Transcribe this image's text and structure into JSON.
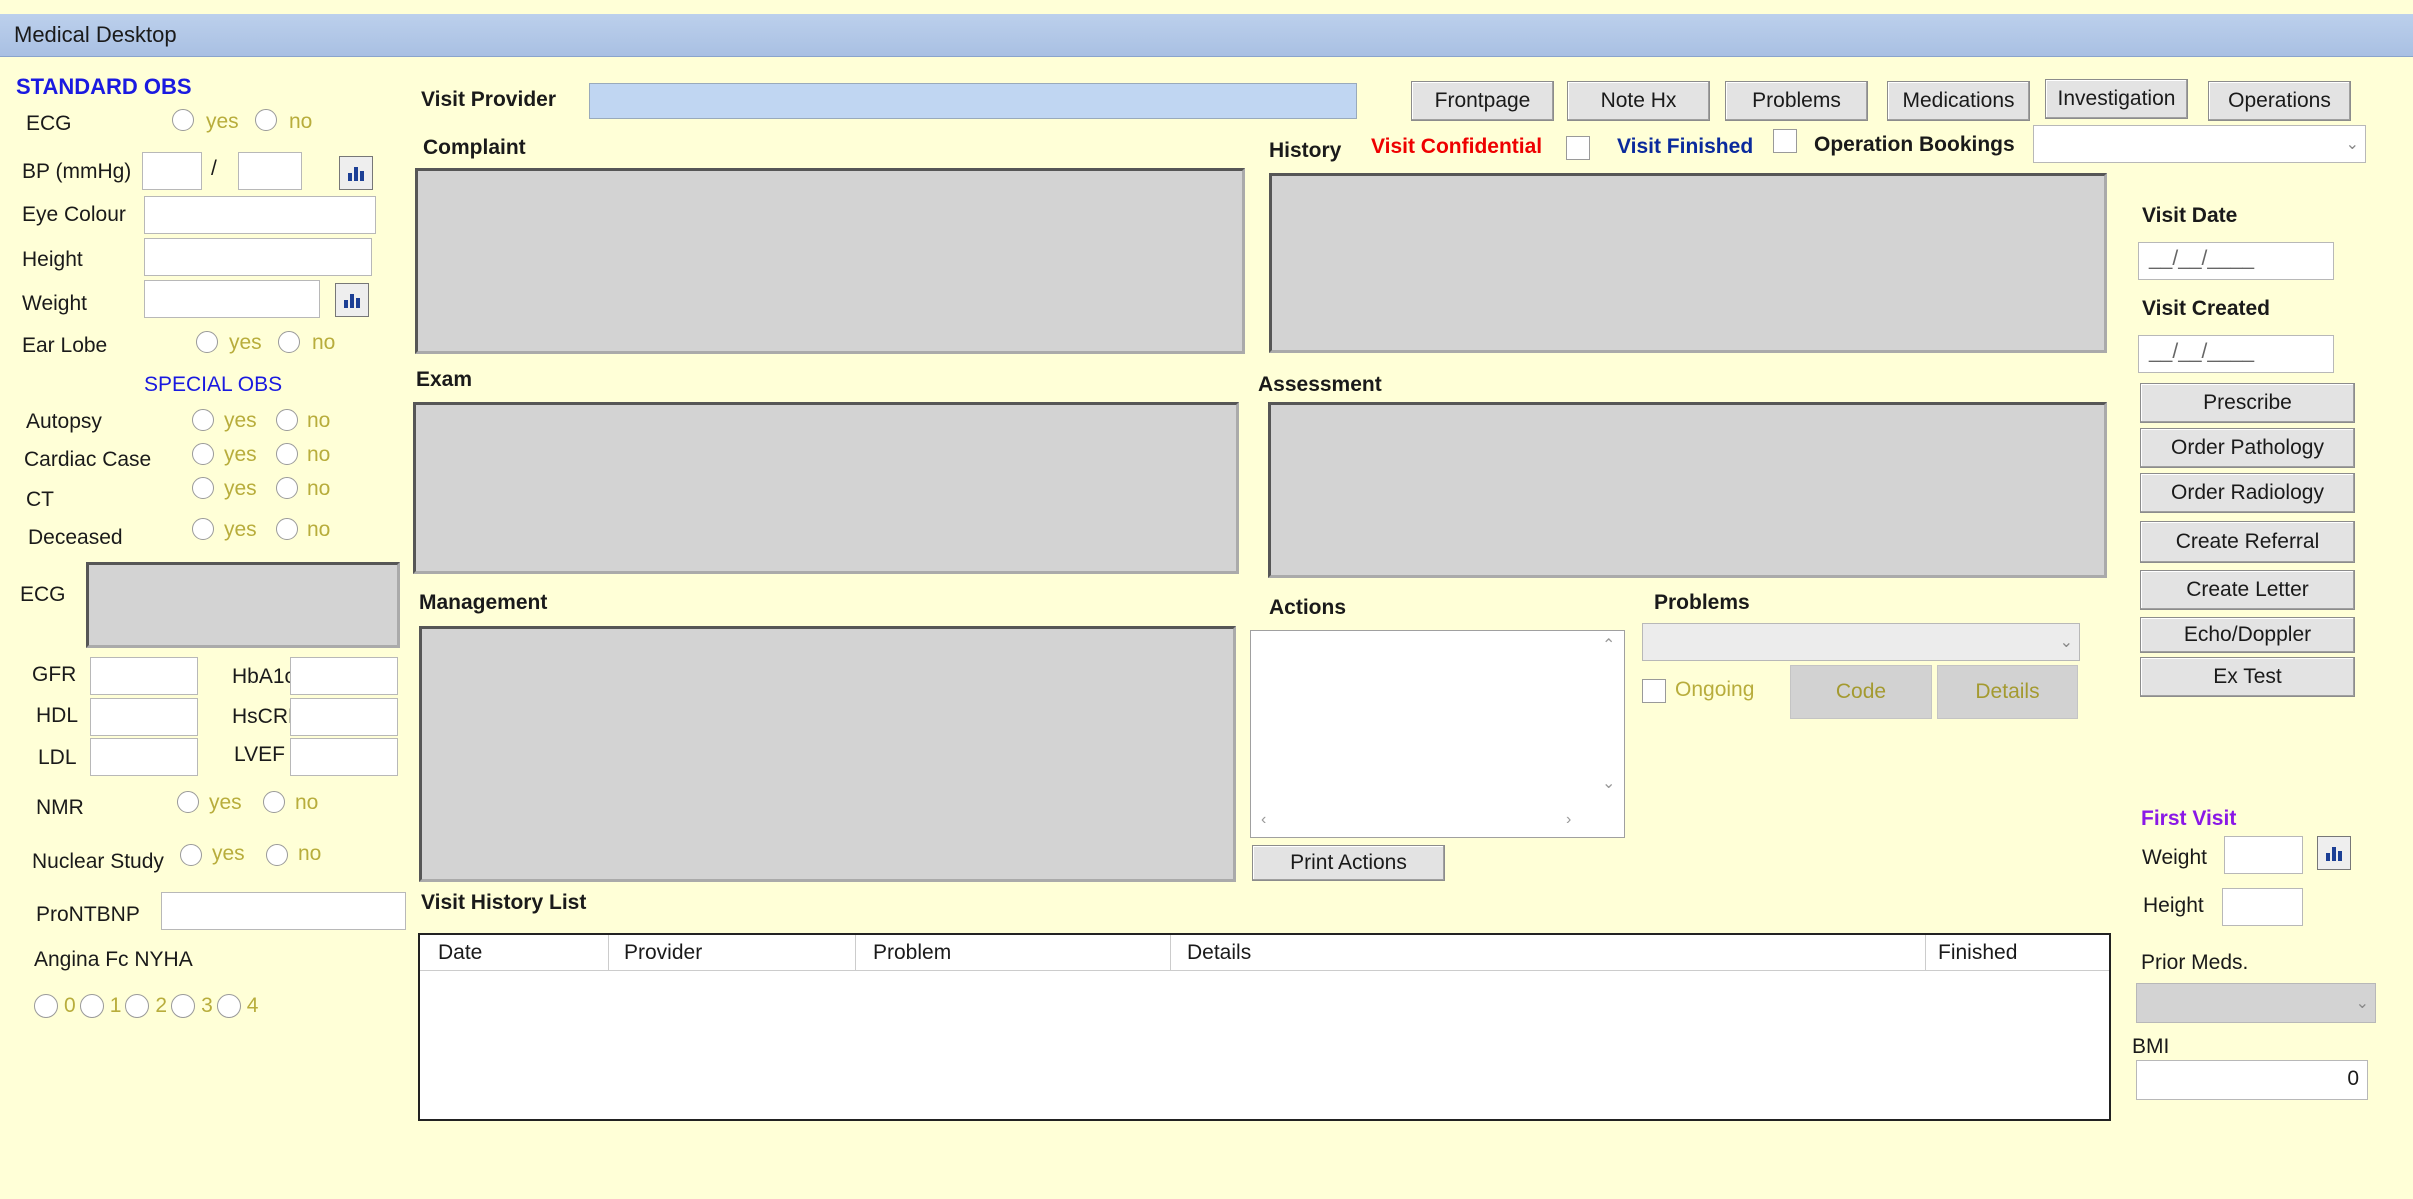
{
  "window": {
    "title": "Medical Desktop"
  },
  "std_obs": {
    "title": "STANDARD OBS",
    "ecg": "ECG",
    "bp": "BP (mmHg)",
    "bp_sep": "/",
    "eye_colour": "Eye Colour",
    "height": "Height",
    "weight": "Weight",
    "ear_lobe": "Ear Lobe"
  },
  "special_obs": {
    "title": "SPECIAL OBS",
    "autopsy": "Autopsy",
    "cardiac": "Cardiac Case",
    "ct": "CT",
    "deceased": "Deceased"
  },
  "yes": "yes",
  "no": "no",
  "labs": {
    "ecg": "ECG",
    "gfr": "GFR",
    "hba1c": "HbA1c",
    "hdl": "HDL",
    "hscrp": "HsCRP",
    "ldl": "LDL",
    "lvef": "LVEF",
    "nmr": "NMR",
    "nuclear": "Nuclear Study",
    "pronbnp": "ProNTBNP",
    "angina": "Angina Fc NYHA"
  },
  "angina_options": [
    "0",
    "1",
    "2",
    "3",
    "4"
  ],
  "visit": {
    "provider_label": "Visit Provider",
    "provider_value": "",
    "complaint": "Complaint",
    "history": "History",
    "exam": "Exam",
    "assessment": "Assessment",
    "management": "Management",
    "confidential": "Visit Confidential",
    "finished": "Visit Finished",
    "op_bookings": "Operation Bookings",
    "actions": "Actions",
    "print_actions": "Print Actions",
    "problems": "Problems",
    "ongoing": "Ongoing",
    "code": "Code",
    "details": "Details",
    "history_list": "Visit History List"
  },
  "nav_buttons": [
    "Frontpage",
    "Note Hx",
    "Problems",
    "Medications",
    "Investigation",
    "Operations"
  ],
  "history_columns": [
    "Date",
    "Provider",
    "Problem",
    "Details",
    "Finished"
  ],
  "right": {
    "visit_date": "Visit Date",
    "visit_date_value": "__/__/____",
    "visit_created": "Visit Created",
    "visit_created_value": "__/__/____",
    "buttons": [
      "Prescribe",
      "Order Pathology",
      "Order Radiology",
      "Create Referral",
      "Create Letter",
      "Echo/Doppler",
      "Ex Test"
    ],
    "first_visit": "First Visit",
    "weight": "Weight",
    "height": "Height",
    "prior_meds": "Prior Meds.",
    "bmi": "BMI",
    "bmi_value": "0"
  },
  "colors": {
    "background": "#ffffd7",
    "accent_blue": "#1a1ae0",
    "red": "#ee0000",
    "purple": "#8a18e6",
    "option_text": "#b8ad3c"
  }
}
